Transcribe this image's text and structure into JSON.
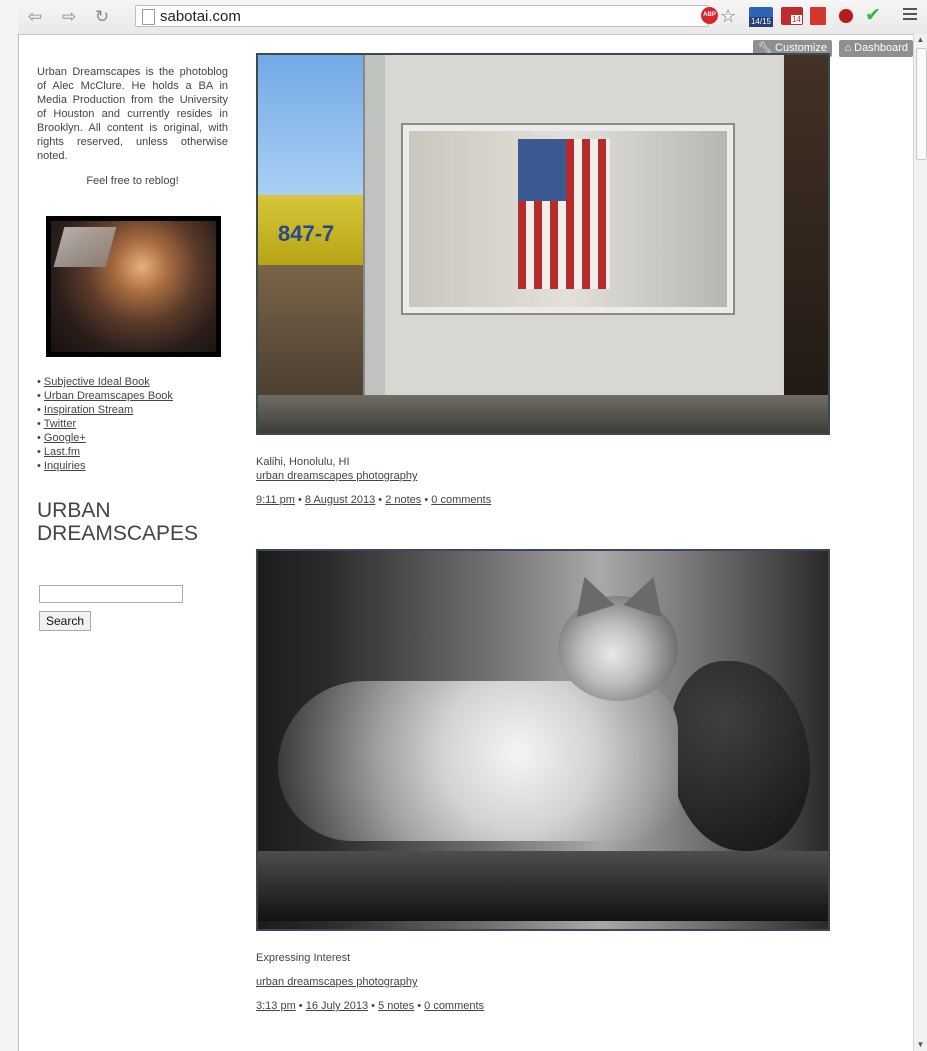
{
  "browser": {
    "url": "sabotai.com",
    "calendar_badge": "14/15",
    "mail_badge": "14",
    "adblock_label": "ABP"
  },
  "top_controls": {
    "customize": "Customize",
    "dashboard": "Dashboard"
  },
  "sidebar": {
    "about": "Urban Dreamscapes is the photoblog of Alec McClure. He holds a BA in Media Production from the University of Houston and currently resides in Brooklyn. All content is original, with rights reserved, unless otherwise noted.",
    "reblog": "Feel free to reblog!",
    "links": [
      "Subjective Ideal Book",
      "Urban Dreamscapes Book",
      "Inspiration Stream",
      "Twitter",
      "Google+",
      "Last.fm",
      "Inquiries"
    ],
    "blog_title": "URBAN DREAMSCAPES",
    "search_button": "Search"
  },
  "posts": [
    {
      "photo_text": "847-7",
      "caption": "Kalihi, Honolulu, HI",
      "tag": "urban dreamscapes photography",
      "time": "9:11 pm",
      "date": "8 August 2013",
      "notes": "2 notes",
      "comments": "0 comments"
    },
    {
      "caption": "Expressing Interest",
      "tag": "urban dreamscapes photography",
      "time": "3:13 pm",
      "date": "16 July 2013",
      "notes": "5 notes",
      "comments": "0 comments"
    }
  ]
}
